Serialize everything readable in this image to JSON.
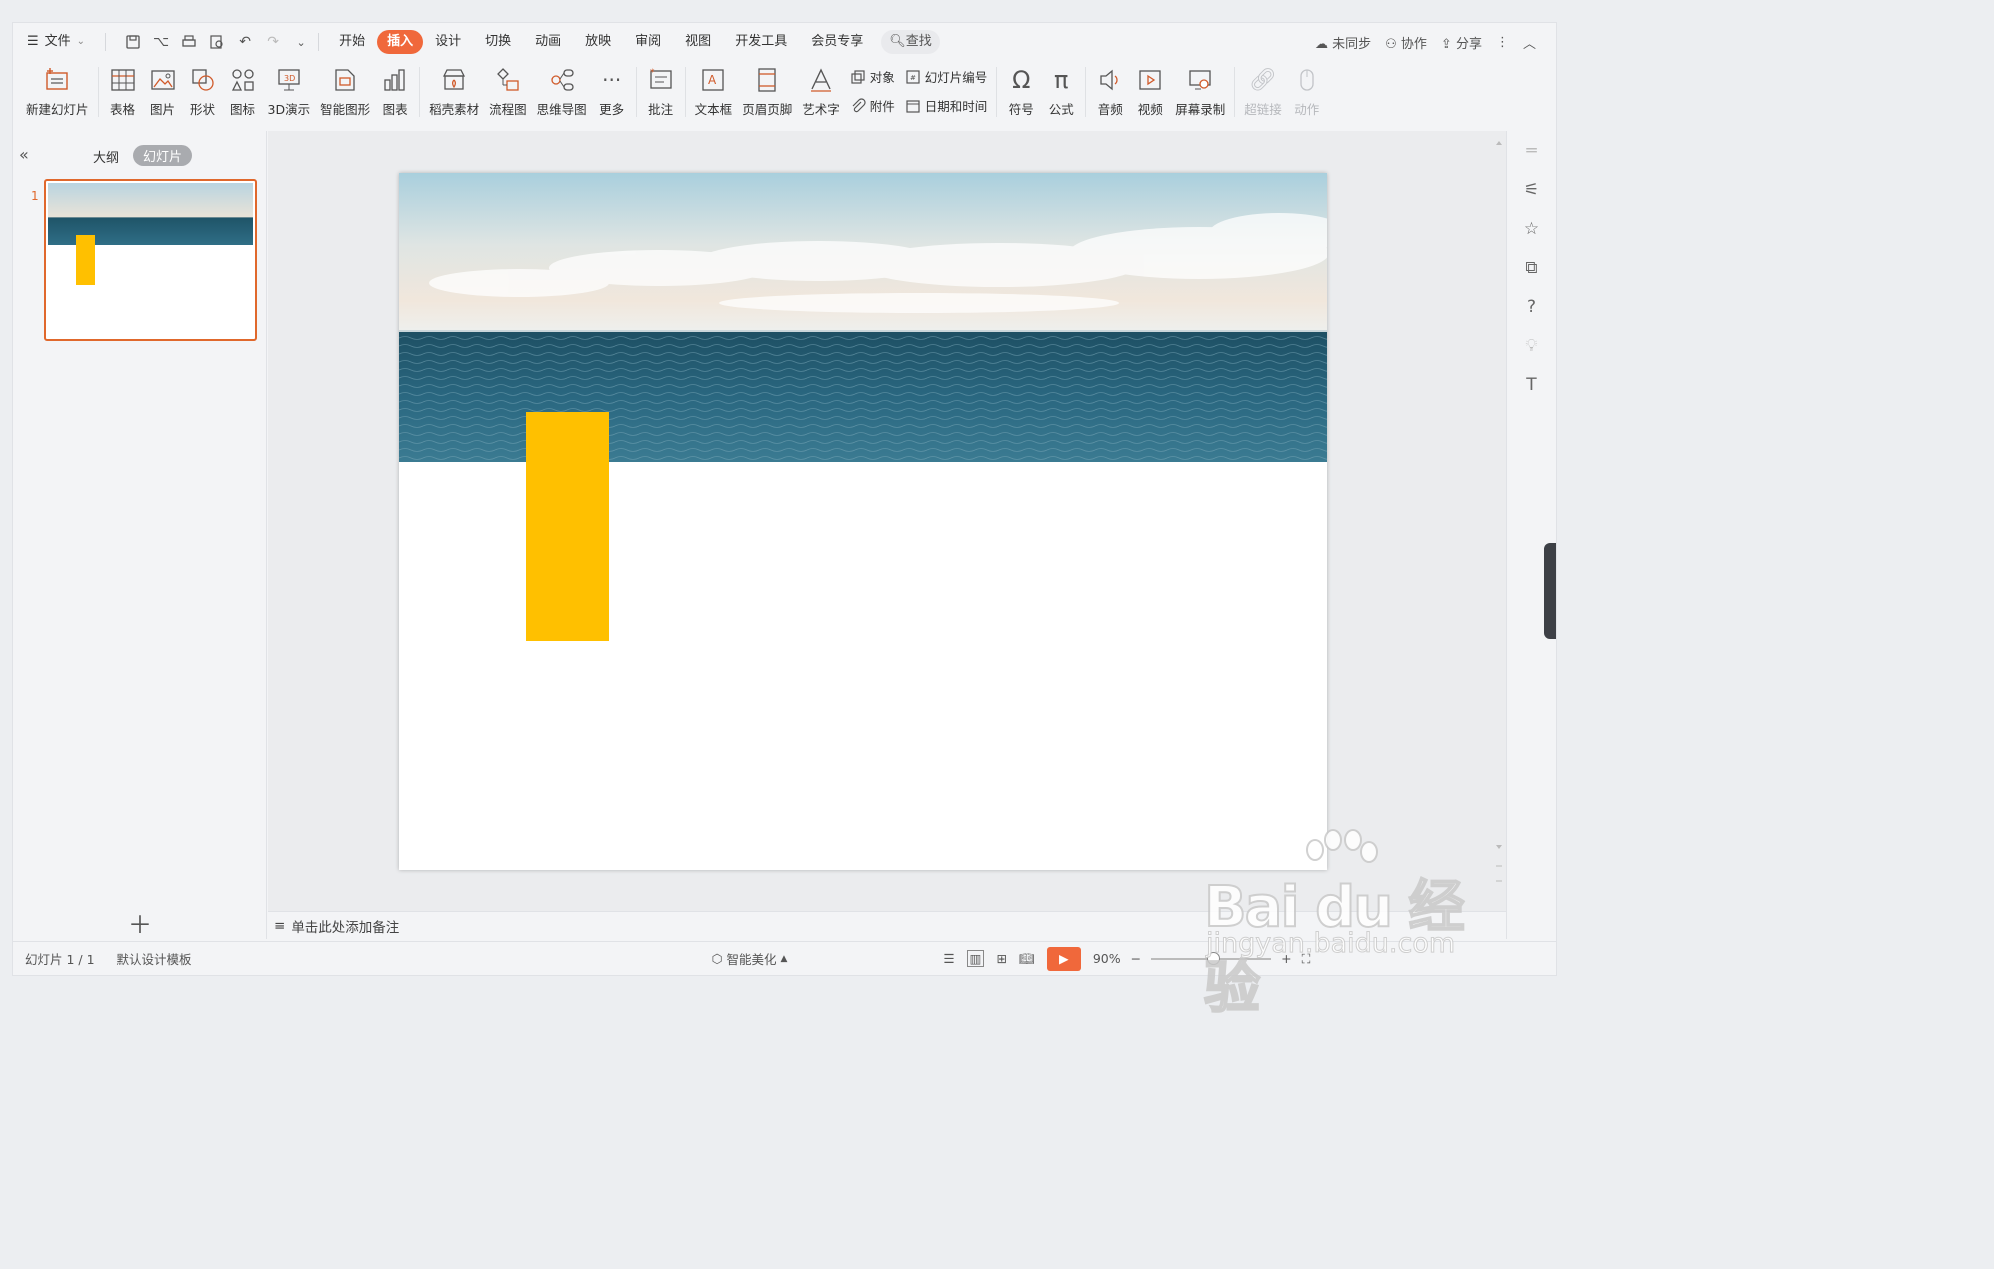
{
  "menubar": {
    "file_label": "文件",
    "tabs": [
      {
        "label": "开始",
        "active": false
      },
      {
        "label": "插入",
        "active": true
      },
      {
        "label": "设计",
        "active": false
      },
      {
        "label": "切换",
        "active": false
      },
      {
        "label": "动画",
        "active": false
      },
      {
        "label": "放映",
        "active": false
      },
      {
        "label": "审阅",
        "active": false
      },
      {
        "label": "视图",
        "active": false
      },
      {
        "label": "开发工具",
        "active": false
      },
      {
        "label": "会员专享",
        "active": false
      }
    ],
    "search_label": "查找",
    "sync_label": "未同步",
    "collab_label": "协作",
    "share_label": "分享"
  },
  "ribbon": {
    "new_slide": "新建幻灯片",
    "table": "表格",
    "picture": "图片",
    "shape": "形状",
    "icon": "图标",
    "demo3d": "3D演示",
    "smartart": "智能图形",
    "chart": "图表",
    "material": "稻壳素材",
    "flowchart": "流程图",
    "mindmap": "思维导图",
    "more": "更多",
    "comment": "批注",
    "textbox": "文本框",
    "header_footer": "页眉页脚",
    "wordart": "艺术字",
    "object": "对象",
    "attachment": "附件",
    "slide_number": "幻灯片编号",
    "datetime": "日期和时间",
    "symbol": "符号",
    "formula": "公式",
    "audio": "音频",
    "video": "视频",
    "screen_record": "屏幕录制",
    "hyperlink": "超链接",
    "action": "动作"
  },
  "leftpanel": {
    "tab_outline": "大纲",
    "tab_slides": "幻灯片",
    "slide_number": "1"
  },
  "notes": {
    "placeholder": "单击此处添加备注"
  },
  "statusbar": {
    "slide_info": "幻灯片 1 / 1",
    "template": "默认设计模板",
    "beautify": "智能美化",
    "zoom": "90%"
  },
  "watermark": {
    "main": "Bai du 经验",
    "sub": "jingyan.baidu.com"
  },
  "colors": {
    "accent": "#f0683b",
    "yellow_block": "#ffc000",
    "sea": "#2f6e86"
  }
}
